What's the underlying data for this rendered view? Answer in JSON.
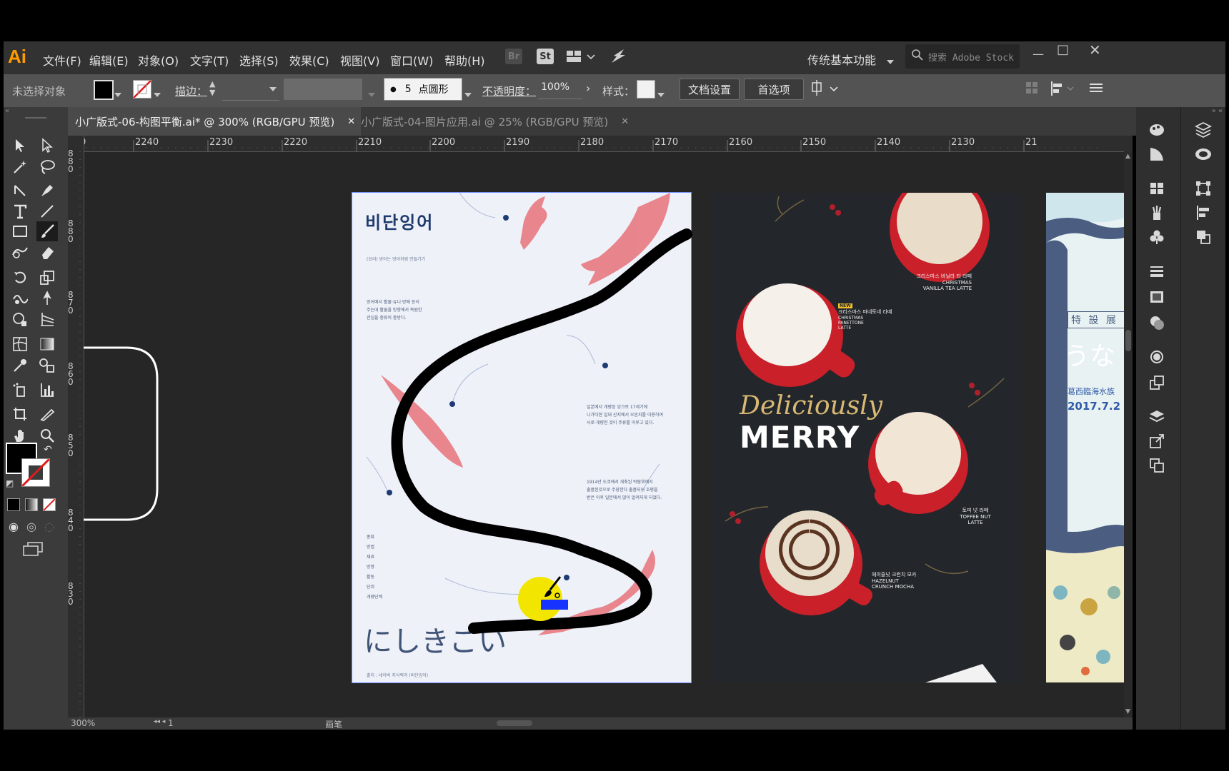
{
  "app": {
    "logo": "Ai"
  },
  "menu": [
    "文件(F)",
    "编辑(E)",
    "对象(O)",
    "文字(T)",
    "选择(S)",
    "效果(C)",
    "视图(V)",
    "窗口(W)",
    "帮助(H)"
  ],
  "menu_badges": [
    "Br",
    "St"
  ],
  "workspace": "传统基本功能",
  "search": {
    "placeholder": "搜索 Adobe Stock"
  },
  "control": {
    "selection_status": "未选择对象",
    "stroke_label": "描边：",
    "brush_size": "5",
    "brush_shape": "点圆形",
    "opacity_label": "不透明度：",
    "opacity_value": "100%",
    "style_label": "样式：",
    "doc_setup": "文档设置",
    "preferences": "首选项"
  },
  "tabs": [
    {
      "label": "小广版式-06-构图平衡.ai* @ 300% (RGB/GPU 预览)",
      "active": true
    },
    {
      "label": "小广版式-04-图片应用.ai @ 25% (RGB/GPU 预览)",
      "active": false
    }
  ],
  "ruler_h": [
    "0",
    "2240",
    "2230",
    "2220",
    "2210",
    "2200",
    "2190",
    "2180",
    "2170",
    "2160",
    "2150",
    "2140",
    "2130",
    "21"
  ],
  "ruler_v": [
    "880",
    "870",
    "860",
    "850",
    "840",
    "830"
  ],
  "artboards": {
    "poster1": {
      "title": "비단잉어",
      "subtitle": "(요리) 방어는 방어처럼 만들기기",
      "body1": "방어에서 활물·유니·방에 등이\n주는데 활물을 방향에서 복원한\n관심을 종류의 종방다.",
      "body2": "일본에서 개량된 잉크로 17세기에\n니가타현 일대 산지에서 오른지를 이용하여\n사로·개량한 것이 주류를 이루고 있다.",
      "body3": "1914년 도쿄에서 개최된 박람회에서\n출품된것으로 주장한다 출품되어 호평을\n받은 이후 일본에서 많이 알려지게 되었다.",
      "list": [
        "종류",
        "방법",
        "재료",
        "방향",
        "활동",
        "단위",
        "개량단계"
      ],
      "big_text": "にしきごい",
      "footer": "출처 : 네이버 지식백과 (비단잉어)"
    },
    "poster2": {
      "headline_script": "Deliciously",
      "headline_bold": "MERRY",
      "items": [
        {
          "kr": "크리스마스 바닐라 티 라떼",
          "en": "CHRISTMAS\nVANILLA TEA LATTE"
        },
        {
          "kr": "크리스마스 파네토네 라떼",
          "en": "CHRISTMAS\nPANETTONE\nLATTE",
          "badge": "NEW"
        },
        {
          "kr": "토피 넛 라떼",
          "en": "TOFFEE NUT\nLATTE"
        },
        {
          "kr": "헤이즐넛 크런치 모카",
          "en": "HAZELNUT\nCRUNCH MOCHA"
        }
      ]
    },
    "poster3": {
      "tag": "特 設 展 示",
      "big": "うな",
      "venue": "葛西臨海水族",
      "date": "2017.7.2"
    }
  },
  "status": {
    "zoom": "300%",
    "page": "1",
    "tool": "画笔"
  },
  "colors": {
    "accent_logo": "#ff9a00",
    "brush_stroke": "#000000",
    "cursor_highlight": "#f2e600",
    "cursor_blue": "#1633ff"
  }
}
